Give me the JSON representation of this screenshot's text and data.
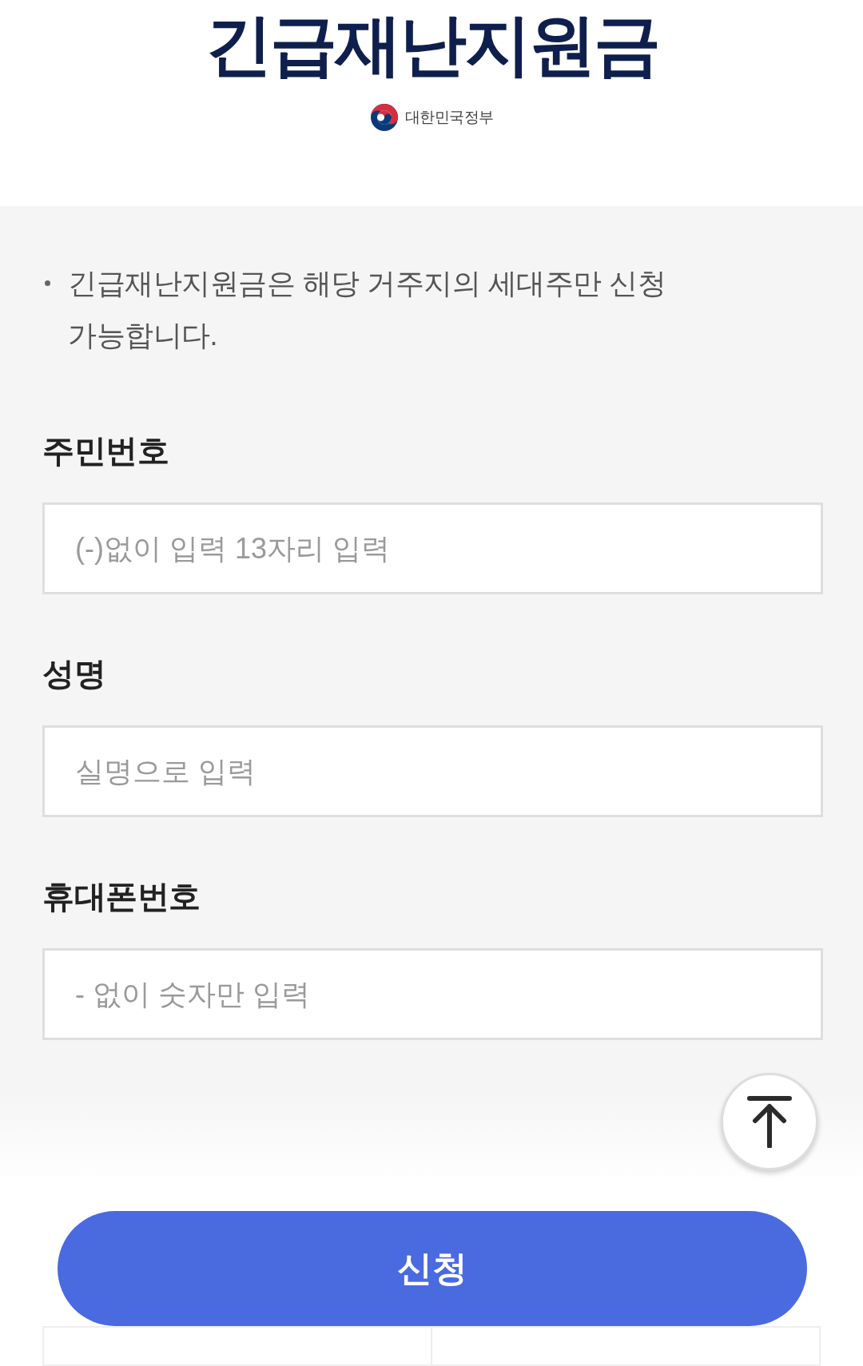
{
  "header": {
    "title": "긴급재난지원금",
    "ministry": "대한민국정부"
  },
  "notice": {
    "text": "긴급재난지원금은 해당 거주지의 세대주만 신청 가능합니다."
  },
  "form": {
    "fields": [
      {
        "label": "주민번호",
        "placeholder": "(-)없이 입력 13자리 입력"
      },
      {
        "label": "성명",
        "placeholder": "실명으로 입력"
      },
      {
        "label": "휴대폰번호",
        "placeholder": "- 없이 숫자만 입력"
      }
    ]
  },
  "submit_button": {
    "label": "신청"
  }
}
